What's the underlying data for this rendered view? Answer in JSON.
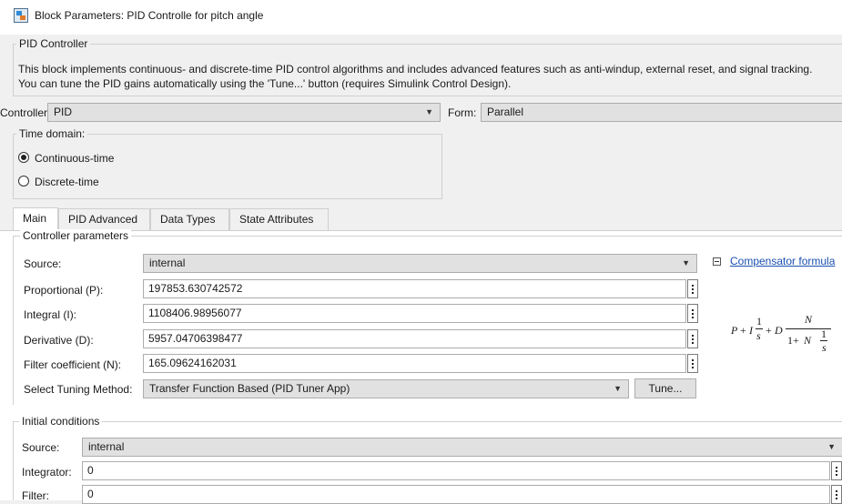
{
  "window": {
    "title": "Block Parameters: PID Controlle for pitch angle",
    "icon": "simulink-block-icon"
  },
  "header": {
    "group_label": "PID Controller",
    "description": "This block implements continuous- and discrete-time PID control algorithms and includes advanced features such as anti-windup, external reset, and signal tracking. You can tune the PID gains automatically using the 'Tune...' button (requires Simulink Control Design)."
  },
  "controller": {
    "label": "Controller:",
    "value": "PID"
  },
  "form": {
    "label": "Form:",
    "value": "Parallel"
  },
  "time_domain": {
    "label": "Time domain:",
    "options": [
      {
        "label": "Continuous-time",
        "selected": true
      },
      {
        "label": "Discrete-time",
        "selected": false
      }
    ]
  },
  "tabs": [
    {
      "label": "Main",
      "active": true
    },
    {
      "label": "PID Advanced",
      "active": false
    },
    {
      "label": "Data Types",
      "active": false
    },
    {
      "label": "State Attributes",
      "active": false
    }
  ],
  "controller_parameters": {
    "group_label": "Controller parameters",
    "source_label": "Source:",
    "source_value": "internal",
    "proportional_label": "Proportional (P):",
    "proportional_value": "197853.630742572",
    "integral_label": "Integral (I):",
    "integral_value": "1108406.98956077",
    "derivative_label": "Derivative (D):",
    "derivative_value": "5957.04706398477",
    "filter_label": "Filter coefficient (N):",
    "filter_value": "165.09624162031",
    "tuning_label": "Select Tuning Method:",
    "tuning_value": "Transfer Function Based (PID Tuner App)",
    "tune_button": "Tune...",
    "compensator_link": "Compensator formula"
  },
  "formula": {
    "p": "P",
    "plus1": "+",
    "i": "I",
    "one_a": "1",
    "s_a": "s",
    "plus2": "+",
    "d": "D",
    "n_num": "N",
    "one_plus": "1+",
    "n_den": "N",
    "one_b": "1",
    "s_b": "s"
  },
  "initial_conditions": {
    "group_label": "Initial conditions",
    "source_label": "Source:",
    "source_value": "internal",
    "integrator_label": "Integrator:",
    "integrator_value": "0",
    "filter_label": "Filter:",
    "filter_value": "0"
  }
}
